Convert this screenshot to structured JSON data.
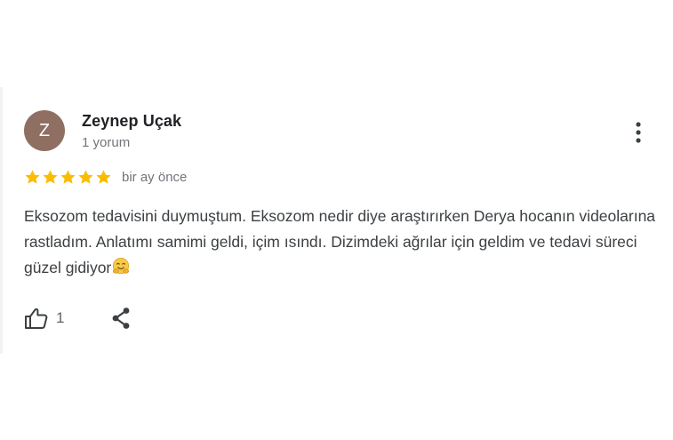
{
  "review": {
    "author": {
      "initial": "Z",
      "name": "Zeynep Uçak",
      "review_count": "1 yorum",
      "avatar_color": "#8f6f62"
    },
    "rating": {
      "stars": 5,
      "max": 5,
      "star_color": "#fbbc04"
    },
    "date": "bir ay önce",
    "text": "Eksozom tedavisini duymuştum. Eksozom nedir diye araştırırken Derya hocanın videolarına rastladım. Anlatımı samimi geldi, içim ısındı. Dizimdeki ağrılar için geldim ve tedavi süreci güzel gidiyor",
    "text_emoji": "hugging-face-emoji",
    "actions": {
      "like_icon": "thumbs-up-icon",
      "like_count": "1",
      "share_icon": "share-icon",
      "menu_icon": "more-vert-icon"
    }
  }
}
